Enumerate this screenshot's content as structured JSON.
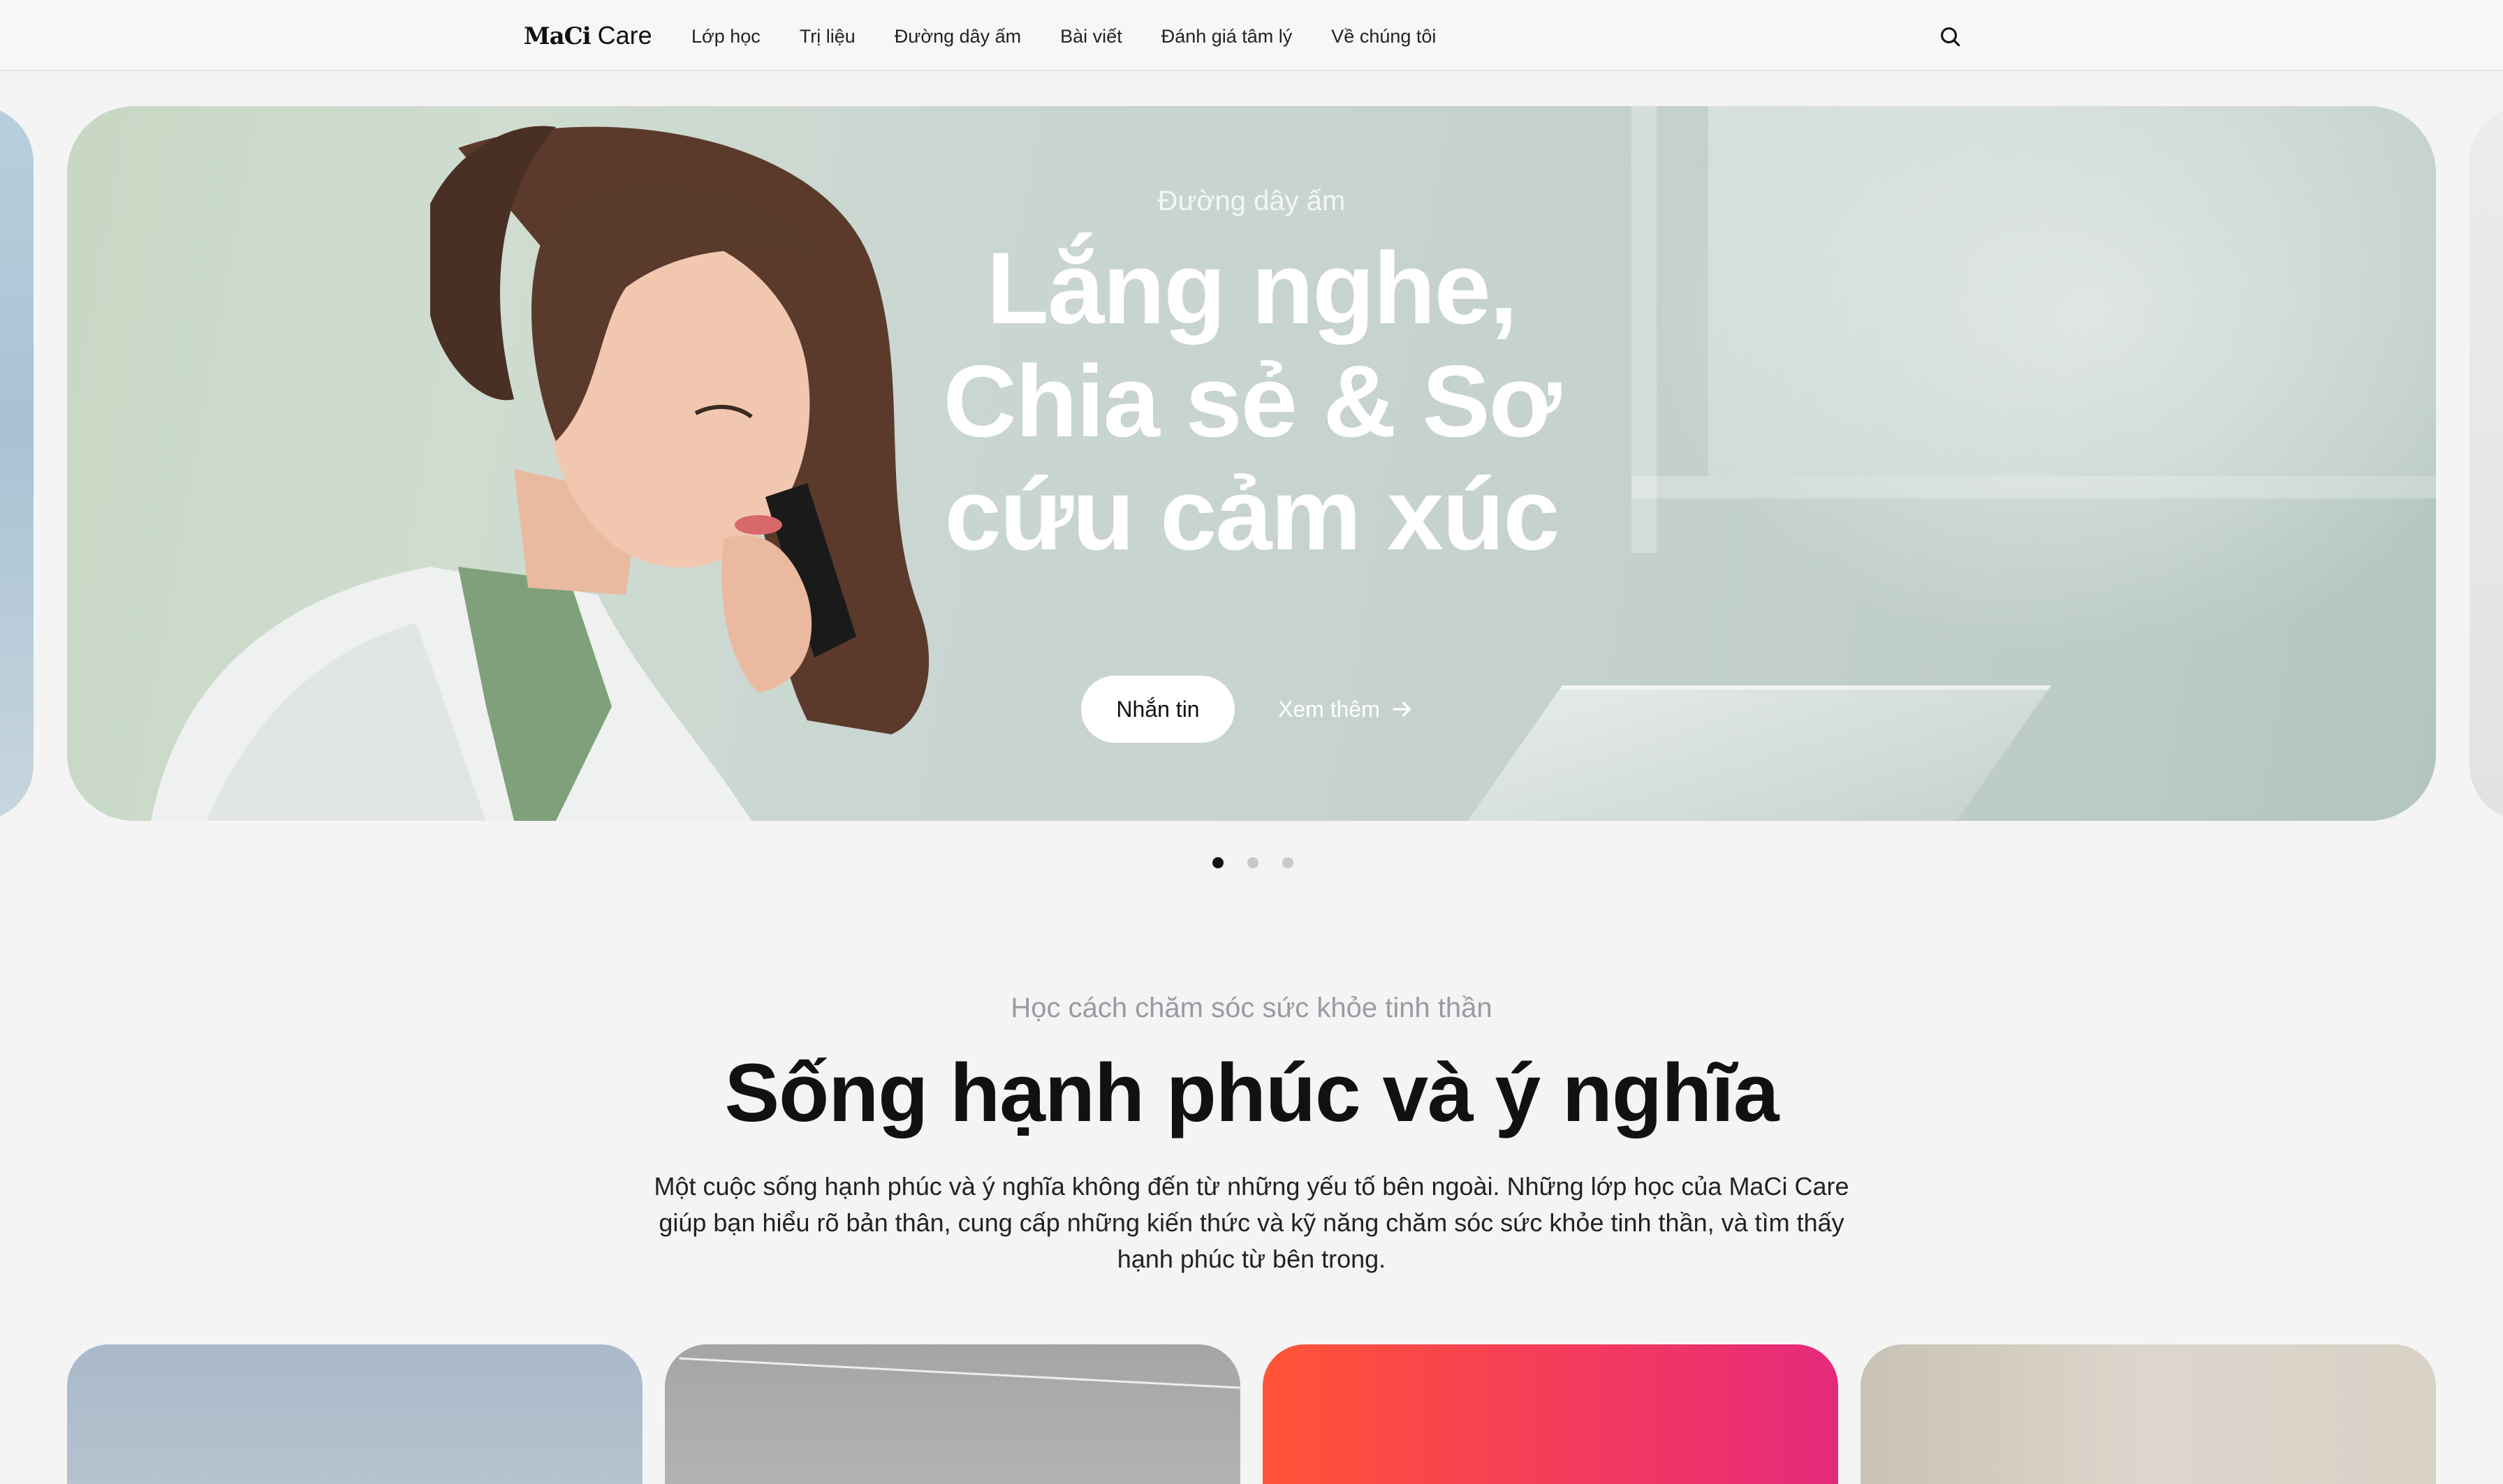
{
  "nav": {
    "logo_mark": "MaCi",
    "logo_word": "Care",
    "items": [
      {
        "label": "Lớp học"
      },
      {
        "label": "Trị liệu"
      },
      {
        "label": "Đường dây ấm"
      },
      {
        "label": "Bài viết"
      },
      {
        "label": "Đánh giá tâm lý"
      },
      {
        "label": "Về chúng tôi"
      }
    ],
    "search_icon": "search-icon"
  },
  "hero": {
    "eyebrow": "Đường dây ấm",
    "title_lines": [
      "Lắng nghe,",
      "Chia sẻ & Sơ",
      "cứu cảm xúc"
    ],
    "primary_button": "Nhắn tin",
    "secondary_link": "Xem thêm",
    "secondary_icon": "arrow-right-icon",
    "slides": 3,
    "active_slide": 1
  },
  "section": {
    "eyebrow": "Học cách chăm sóc sức khỏe tinh thần",
    "title": "Sống hạnh phúc và ý nghĩa",
    "description": "Một cuộc sống hạnh phúc và ý nghĩa không đến từ những yếu tố bên ngoài. Những lớp học của MaCi Care giúp bạn hiểu rõ bản thân, cung cấp những kiến thức và kỹ năng chăm sóc sức khỏe tinh thần, và tìm thấy hạnh phúc từ bên trong."
  },
  "colors": {
    "accent_gradient_start": "#ff5436",
    "accent_gradient_end": "#e42a7b",
    "background": "#f4f4f5",
    "text": "#111111"
  }
}
